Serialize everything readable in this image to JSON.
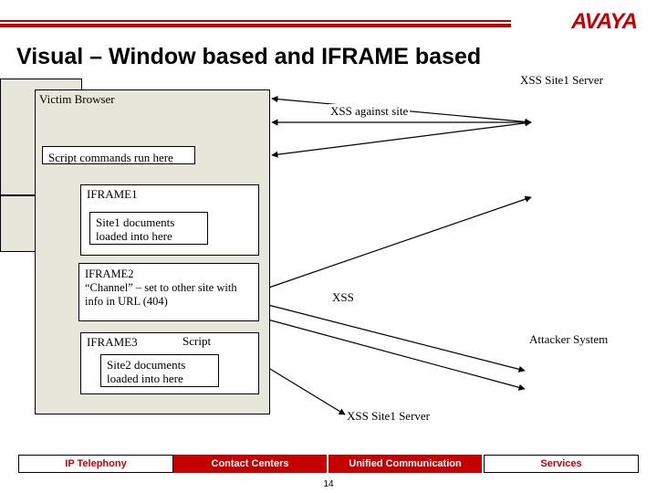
{
  "brand": {
    "logo": "AVAYA"
  },
  "title": "Visual – Window based and IFRAME based",
  "labels": {
    "victim_browser": "Victim Browser",
    "xss_site1_server": "XSS Site1 Server",
    "xss_against_site": "XSS against site",
    "script_commands": "Script commands run here",
    "iframe1": "IFRAME1",
    "site1_docs": "Site1 documents loaded into here",
    "iframe2_title": "IFRAME2",
    "iframe2_desc": "“Channel” – set to other site with info in URL (404)",
    "iframe3": "IFRAME3",
    "script": "Script",
    "site2_docs": "Site2 documents loaded into here",
    "xss": "XSS",
    "attacker_system": "Attacker System",
    "xss_site1_server_bottom": "XSS Site1 Server"
  },
  "footer": {
    "items": [
      "IP Telephony",
      "Contact Centers",
      "Unified Communication",
      "Services"
    ]
  },
  "page_number": "14"
}
